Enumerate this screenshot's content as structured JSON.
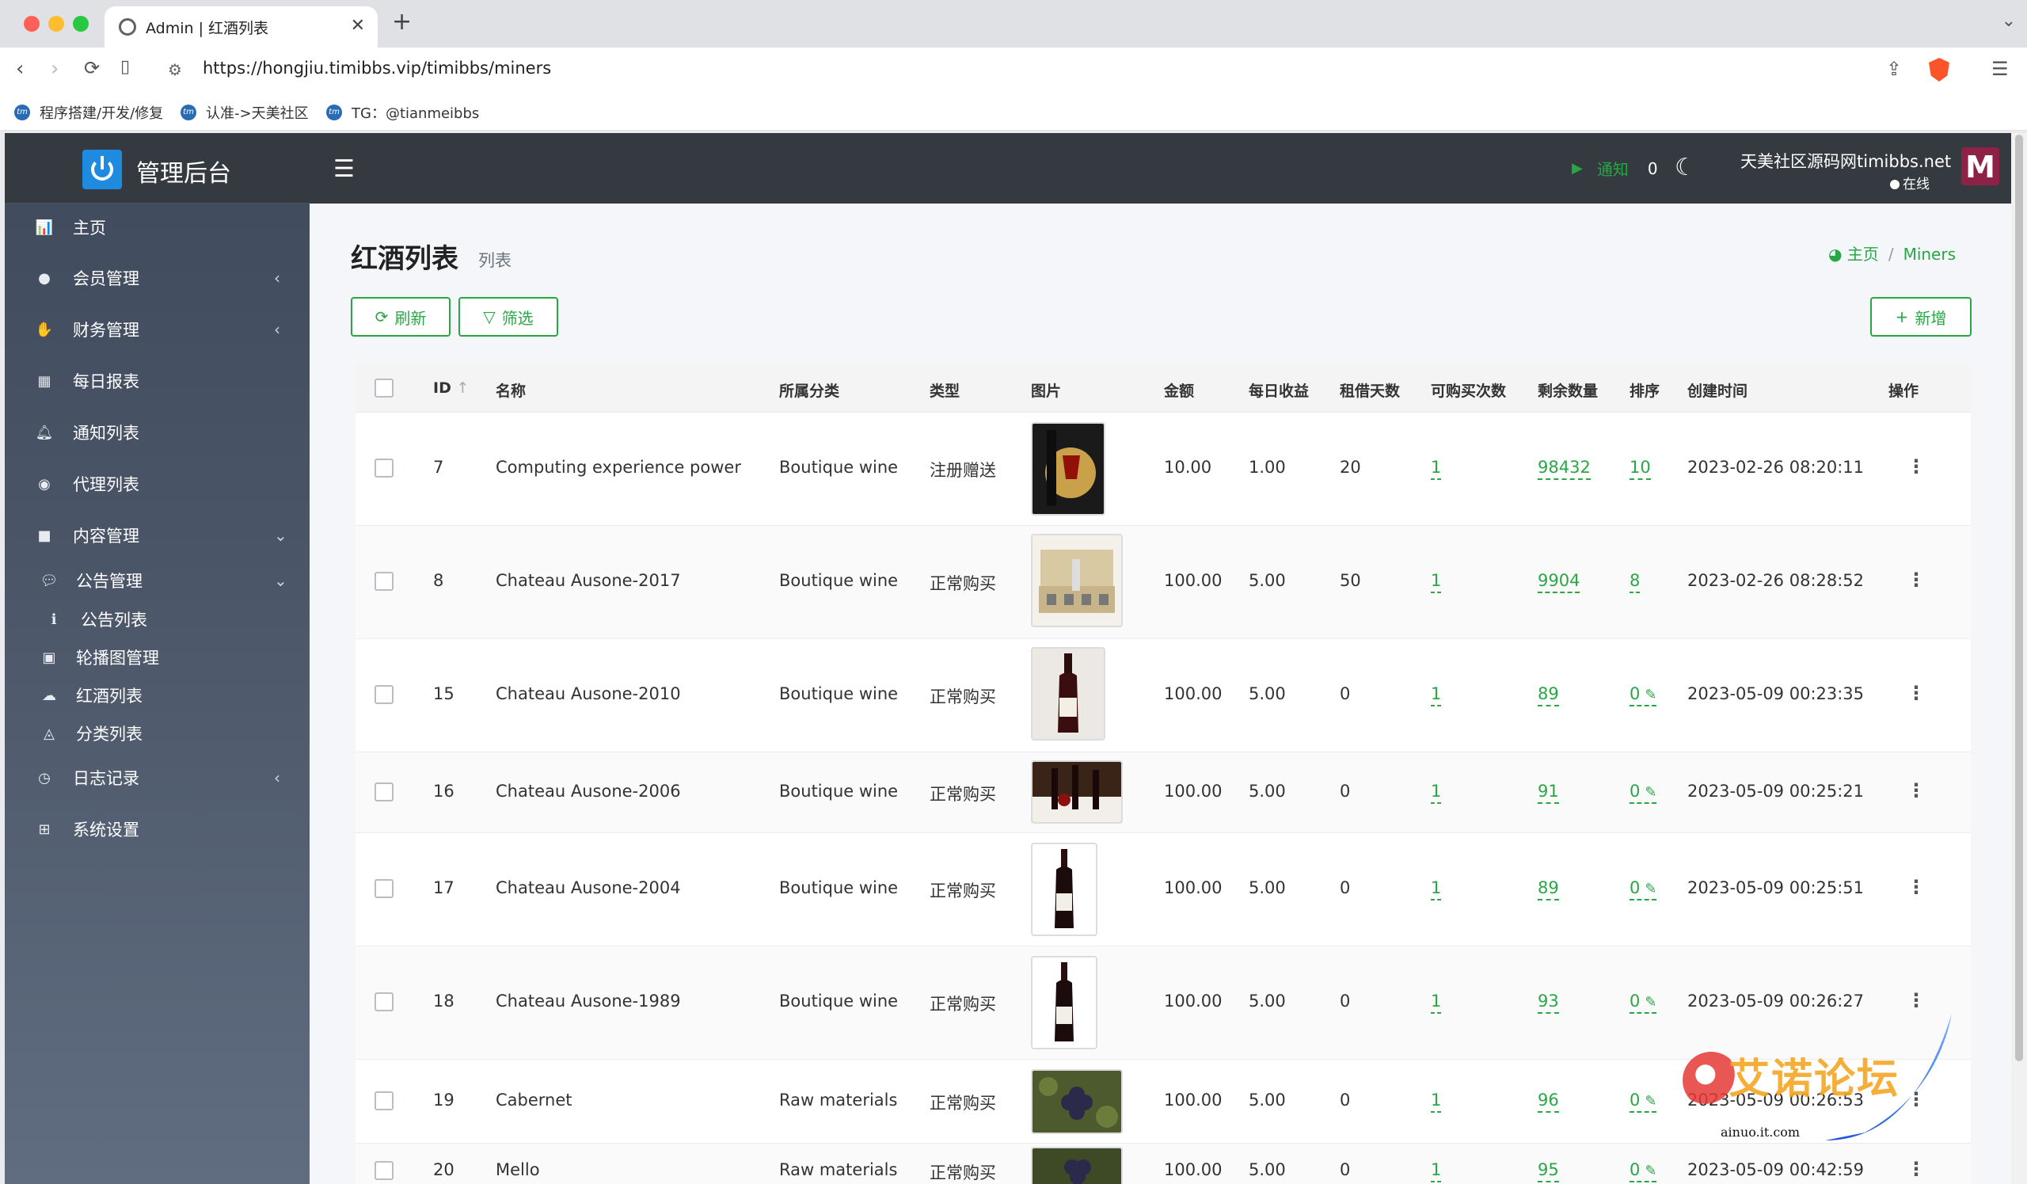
{
  "browser": {
    "tab_title": "Admin | 红酒列表",
    "url": "https://hongjiu.timibbs.vip/timibbs/miners",
    "bookmarks": [
      "程序搭建/开发/修复",
      "认准->天美社区",
      "TG：@tianmeibbs"
    ]
  },
  "brand": {
    "title": "管理后台"
  },
  "sidebar": {
    "items": [
      {
        "label": "主页",
        "icon": "chart-bar-icon"
      },
      {
        "label": "会员管理",
        "icon": "user-icon",
        "chevron": "‹"
      },
      {
        "label": "财务管理",
        "icon": "money-icon",
        "chevron": "‹"
      },
      {
        "label": "每日报表",
        "icon": "calendar-icon"
      },
      {
        "label": "通知列表",
        "icon": "bell-icon"
      },
      {
        "label": "代理列表",
        "icon": "agent-icon"
      },
      {
        "label": "内容管理",
        "icon": "bookmark-icon",
        "chevron": "⌄"
      },
      {
        "label": "公告管理",
        "icon": "comments-icon",
        "chevron": "⌄"
      },
      {
        "label": "公告列表",
        "icon": "info-icon"
      },
      {
        "label": "轮播图管理",
        "icon": "image-icon"
      },
      {
        "label": "红酒列表",
        "icon": "cloud-icon"
      },
      {
        "label": "分类列表",
        "icon": "category-icon"
      },
      {
        "label": "日志记录",
        "icon": "clock-icon",
        "chevron": "‹"
      },
      {
        "label": "系统设置",
        "icon": "windows-icon"
      }
    ]
  },
  "topnav": {
    "notify_label": "通知",
    "notify_count": "0",
    "user_name": "天美社区源码网timibbs.net",
    "user_status": "在线",
    "avatar_letter": "M"
  },
  "page": {
    "title": "红酒列表",
    "subtitle": "列表",
    "breadcrumb_home": "主页",
    "breadcrumb_sep": "/",
    "breadcrumb_current": "Miners"
  },
  "buttons": {
    "refresh": "刷新",
    "filter": "筛选",
    "add": "新增"
  },
  "table": {
    "headers": {
      "id": "ID",
      "name": "名称",
      "category": "所属分类",
      "type": "类型",
      "image": "图片",
      "amount": "金额",
      "daily": "每日收益",
      "days": "租借天数",
      "buy_times": "可购买次数",
      "stock": "剩余数量",
      "sort": "排序",
      "created": "创建时间",
      "ops": "操作"
    },
    "rows": [
      {
        "id": "7",
        "name": "Computing experience power",
        "category": "Boutique wine",
        "type": "注册赠送",
        "amount": "10.00",
        "daily": "1.00",
        "days": "20",
        "buy_times": "1",
        "stock": "98432",
        "sort": "10",
        "created": "2023-02-26 08:20:11"
      },
      {
        "id": "8",
        "name": "Chateau Ausone-2017",
        "category": "Boutique wine",
        "type": "正常购买",
        "amount": "100.00",
        "daily": "5.00",
        "days": "50",
        "buy_times": "1",
        "stock": "9904",
        "sort": "8",
        "created": "2023-02-26 08:28:52"
      },
      {
        "id": "15",
        "name": "Chateau Ausone-2010",
        "category": "Boutique wine",
        "type": "正常购买",
        "amount": "100.00",
        "daily": "5.00",
        "days": "0",
        "buy_times": "1",
        "stock": "89",
        "sort": "0",
        "created": "2023-05-09 00:23:35"
      },
      {
        "id": "16",
        "name": "Chateau Ausone-2006",
        "category": "Boutique wine",
        "type": "正常购买",
        "amount": "100.00",
        "daily": "5.00",
        "days": "0",
        "buy_times": "1",
        "stock": "91",
        "sort": "0",
        "created": "2023-05-09 00:25:21"
      },
      {
        "id": "17",
        "name": "Chateau Ausone-2004",
        "category": "Boutique wine",
        "type": "正常购买",
        "amount": "100.00",
        "daily": "5.00",
        "days": "0",
        "buy_times": "1",
        "stock": "89",
        "sort": "0",
        "created": "2023-05-09 00:25:51"
      },
      {
        "id": "18",
        "name": "Chateau Ausone-1989",
        "category": "Boutique wine",
        "type": "正常购买",
        "amount": "100.00",
        "daily": "5.00",
        "days": "0",
        "buy_times": "1",
        "stock": "93",
        "sort": "0",
        "created": "2023-05-09 00:26:27"
      },
      {
        "id": "19",
        "name": "Cabernet",
        "category": "Raw materials",
        "type": "正常购买",
        "amount": "100.00",
        "daily": "5.00",
        "days": "0",
        "buy_times": "1",
        "stock": "96",
        "sort": "0",
        "created": "2023-05-09 00:26:53"
      },
      {
        "id": "20",
        "name": "Mello",
        "category": "Raw materials",
        "type": "正常购买",
        "amount": "100.00",
        "daily": "5.00",
        "days": "0",
        "buy_times": "1",
        "stock": "95",
        "sort": "0",
        "created": "2023-05-09 00:42:59"
      }
    ]
  },
  "watermark": {
    "text": "艾诺论坛",
    "sub": "ainuo.it.com"
  },
  "colors": {
    "accent": "#28a745",
    "navbar": "#343a40",
    "sidebar": "#4a5567"
  }
}
